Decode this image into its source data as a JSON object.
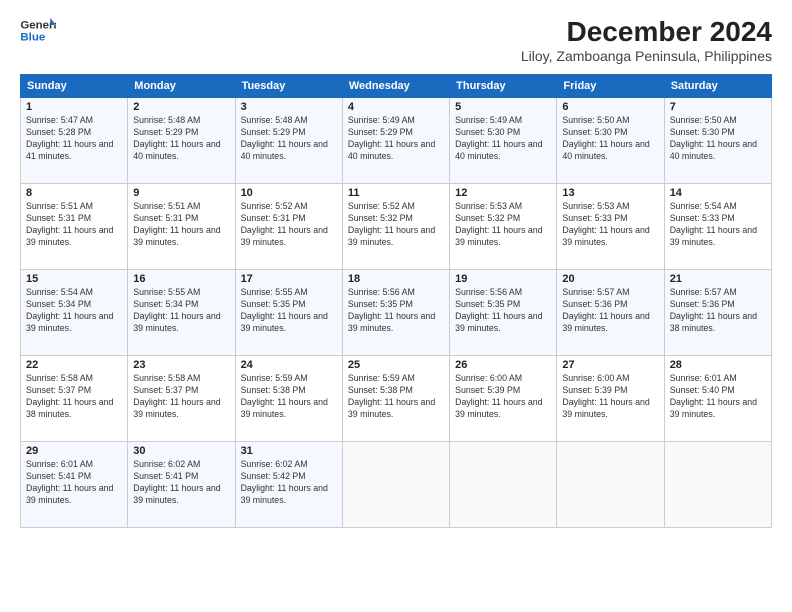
{
  "header": {
    "logo_line1": "General",
    "logo_line2": "Blue",
    "title": "December 2024",
    "subtitle": "Liloy, Zamboanga Peninsula, Philippines"
  },
  "weekdays": [
    "Sunday",
    "Monday",
    "Tuesday",
    "Wednesday",
    "Thursday",
    "Friday",
    "Saturday"
  ],
  "weeks": [
    [
      {
        "day": 1,
        "sunrise": "5:47 AM",
        "sunset": "5:28 PM",
        "daylight": "11 hours and 41 minutes."
      },
      {
        "day": 2,
        "sunrise": "5:48 AM",
        "sunset": "5:29 PM",
        "daylight": "11 hours and 40 minutes."
      },
      {
        "day": 3,
        "sunrise": "5:48 AM",
        "sunset": "5:29 PM",
        "daylight": "11 hours and 40 minutes."
      },
      {
        "day": 4,
        "sunrise": "5:49 AM",
        "sunset": "5:29 PM",
        "daylight": "11 hours and 40 minutes."
      },
      {
        "day": 5,
        "sunrise": "5:49 AM",
        "sunset": "5:30 PM",
        "daylight": "11 hours and 40 minutes."
      },
      {
        "day": 6,
        "sunrise": "5:50 AM",
        "sunset": "5:30 PM",
        "daylight": "11 hours and 40 minutes."
      },
      {
        "day": 7,
        "sunrise": "5:50 AM",
        "sunset": "5:30 PM",
        "daylight": "11 hours and 40 minutes."
      }
    ],
    [
      {
        "day": 8,
        "sunrise": "5:51 AM",
        "sunset": "5:31 PM",
        "daylight": "11 hours and 39 minutes."
      },
      {
        "day": 9,
        "sunrise": "5:51 AM",
        "sunset": "5:31 PM",
        "daylight": "11 hours and 39 minutes."
      },
      {
        "day": 10,
        "sunrise": "5:52 AM",
        "sunset": "5:31 PM",
        "daylight": "11 hours and 39 minutes."
      },
      {
        "day": 11,
        "sunrise": "5:52 AM",
        "sunset": "5:32 PM",
        "daylight": "11 hours and 39 minutes."
      },
      {
        "day": 12,
        "sunrise": "5:53 AM",
        "sunset": "5:32 PM",
        "daylight": "11 hours and 39 minutes."
      },
      {
        "day": 13,
        "sunrise": "5:53 AM",
        "sunset": "5:33 PM",
        "daylight": "11 hours and 39 minutes."
      },
      {
        "day": 14,
        "sunrise": "5:54 AM",
        "sunset": "5:33 PM",
        "daylight": "11 hours and 39 minutes."
      }
    ],
    [
      {
        "day": 15,
        "sunrise": "5:54 AM",
        "sunset": "5:34 PM",
        "daylight": "11 hours and 39 minutes."
      },
      {
        "day": 16,
        "sunrise": "5:55 AM",
        "sunset": "5:34 PM",
        "daylight": "11 hours and 39 minutes."
      },
      {
        "day": 17,
        "sunrise": "5:55 AM",
        "sunset": "5:35 PM",
        "daylight": "11 hours and 39 minutes."
      },
      {
        "day": 18,
        "sunrise": "5:56 AM",
        "sunset": "5:35 PM",
        "daylight": "11 hours and 39 minutes."
      },
      {
        "day": 19,
        "sunrise": "5:56 AM",
        "sunset": "5:35 PM",
        "daylight": "11 hours and 39 minutes."
      },
      {
        "day": 20,
        "sunrise": "5:57 AM",
        "sunset": "5:36 PM",
        "daylight": "11 hours and 39 minutes."
      },
      {
        "day": 21,
        "sunrise": "5:57 AM",
        "sunset": "5:36 PM",
        "daylight": "11 hours and 38 minutes."
      }
    ],
    [
      {
        "day": 22,
        "sunrise": "5:58 AM",
        "sunset": "5:37 PM",
        "daylight": "11 hours and 38 minutes."
      },
      {
        "day": 23,
        "sunrise": "5:58 AM",
        "sunset": "5:37 PM",
        "daylight": "11 hours and 39 minutes."
      },
      {
        "day": 24,
        "sunrise": "5:59 AM",
        "sunset": "5:38 PM",
        "daylight": "11 hours and 39 minutes."
      },
      {
        "day": 25,
        "sunrise": "5:59 AM",
        "sunset": "5:38 PM",
        "daylight": "11 hours and 39 minutes."
      },
      {
        "day": 26,
        "sunrise": "6:00 AM",
        "sunset": "5:39 PM",
        "daylight": "11 hours and 39 minutes."
      },
      {
        "day": 27,
        "sunrise": "6:00 AM",
        "sunset": "5:39 PM",
        "daylight": "11 hours and 39 minutes."
      },
      {
        "day": 28,
        "sunrise": "6:01 AM",
        "sunset": "5:40 PM",
        "daylight": "11 hours and 39 minutes."
      }
    ],
    [
      {
        "day": 29,
        "sunrise": "6:01 AM",
        "sunset": "5:41 PM",
        "daylight": "11 hours and 39 minutes."
      },
      {
        "day": 30,
        "sunrise": "6:02 AM",
        "sunset": "5:41 PM",
        "daylight": "11 hours and 39 minutes."
      },
      {
        "day": 31,
        "sunrise": "6:02 AM",
        "sunset": "5:42 PM",
        "daylight": "11 hours and 39 minutes."
      },
      null,
      null,
      null,
      null
    ]
  ]
}
